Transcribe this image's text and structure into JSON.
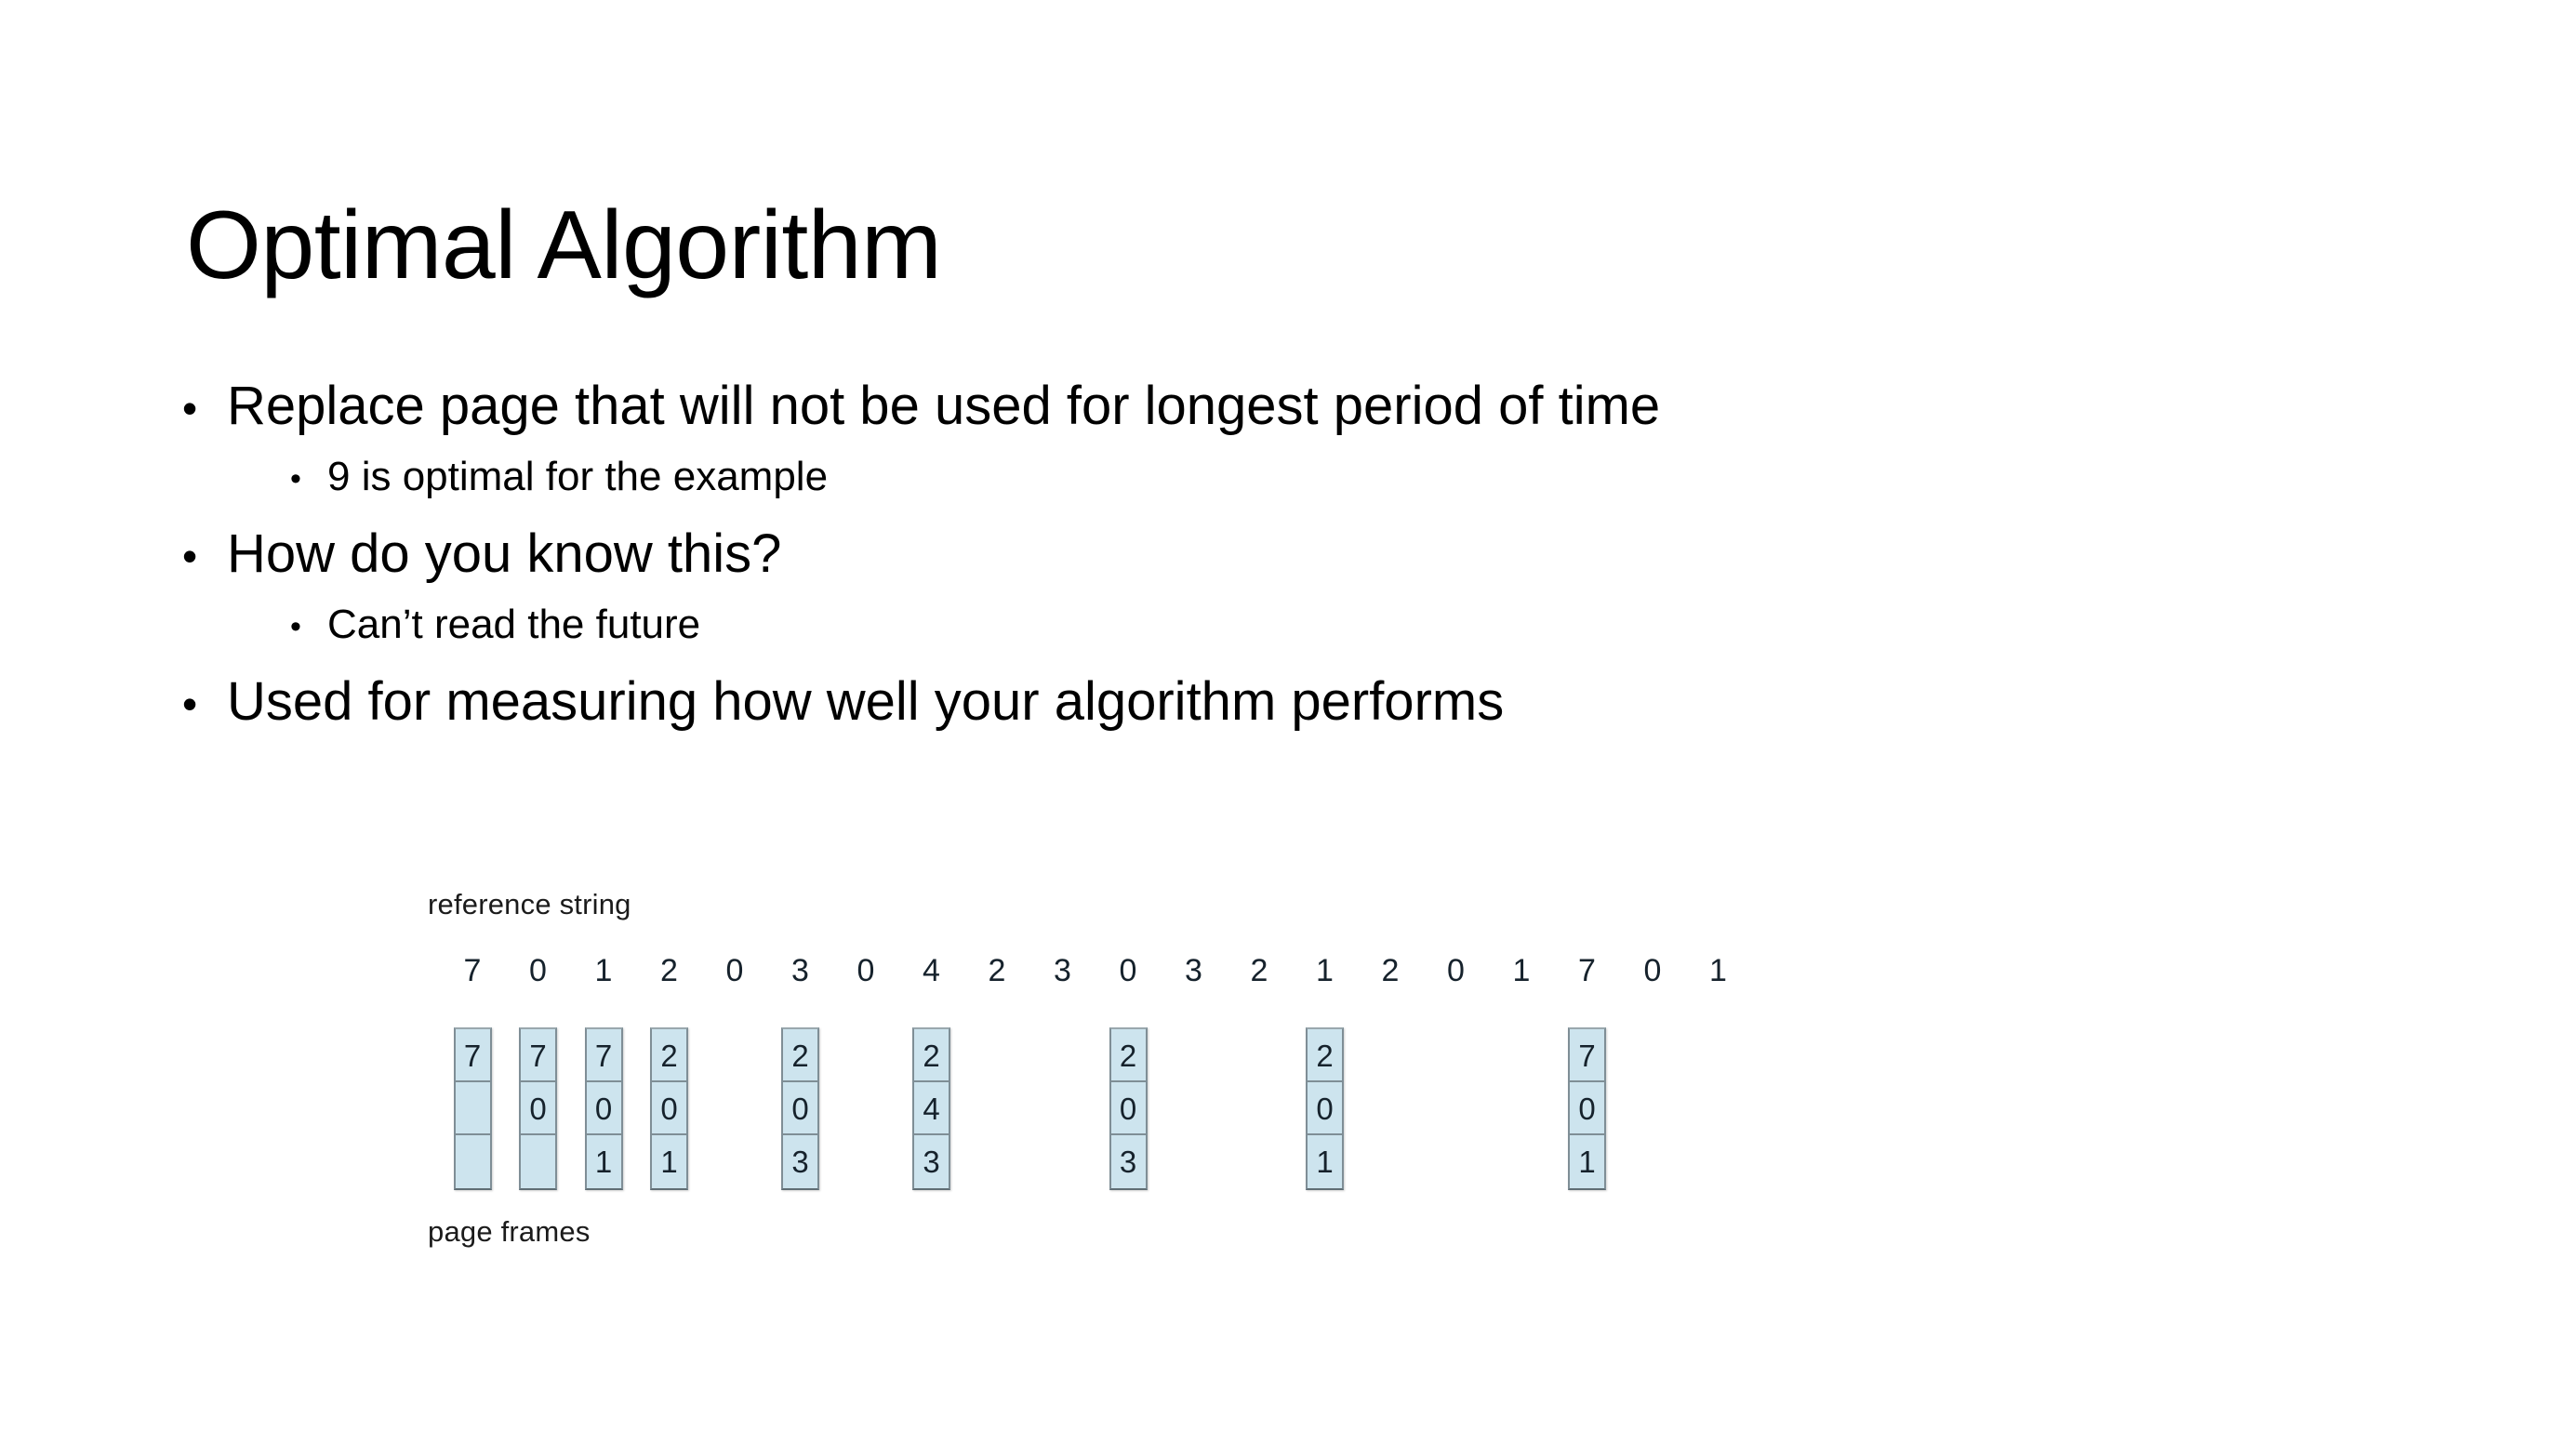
{
  "slide": {
    "title": "Optimal Algorithm",
    "background_color": "#ffffff",
    "text_color": "#000000"
  },
  "bullets": [
    {
      "level": 1,
      "marker": "•",
      "text": "Replace page that will not be used for longest period of time"
    },
    {
      "level": 2,
      "marker": "•",
      "text": "9 is optimal for the example"
    },
    {
      "level": 1,
      "marker": "•",
      "text": "How do you know this?"
    },
    {
      "level": 2,
      "marker": "•",
      "text": "Can’t read the future"
    },
    {
      "level": 1,
      "marker": "•",
      "text": "Used for measuring how well your algorithm performs"
    }
  ],
  "figure": {
    "caption_top": "reference string",
    "caption_bottom": "page frames",
    "cell_fill_color": "#cde4ee",
    "cell_border_color": "#7f8e96",
    "digit_color": "#16222c",
    "reference_string": [
      7,
      0,
      1,
      2,
      0,
      3,
      0,
      4,
      2,
      3,
      0,
      3,
      2,
      1,
      2,
      0,
      1,
      7,
      0,
      1
    ],
    "frame_columns": [
      {
        "ref_index": 0,
        "cells": [
          "7",
          "",
          ""
        ]
      },
      {
        "ref_index": 1,
        "cells": [
          "7",
          "0",
          ""
        ]
      },
      {
        "ref_index": 2,
        "cells": [
          "7",
          "0",
          "1"
        ]
      },
      {
        "ref_index": 3,
        "cells": [
          "2",
          "0",
          "1"
        ]
      },
      {
        "ref_index": 5,
        "cells": [
          "2",
          "0",
          "3"
        ]
      },
      {
        "ref_index": 7,
        "cells": [
          "2",
          "4",
          "3"
        ]
      },
      {
        "ref_index": 10,
        "cells": [
          "2",
          "0",
          "3"
        ]
      },
      {
        "ref_index": 13,
        "cells": [
          "2",
          "0",
          "1"
        ]
      },
      {
        "ref_index": 17,
        "cells": [
          "7",
          "0",
          "1"
        ]
      }
    ]
  }
}
